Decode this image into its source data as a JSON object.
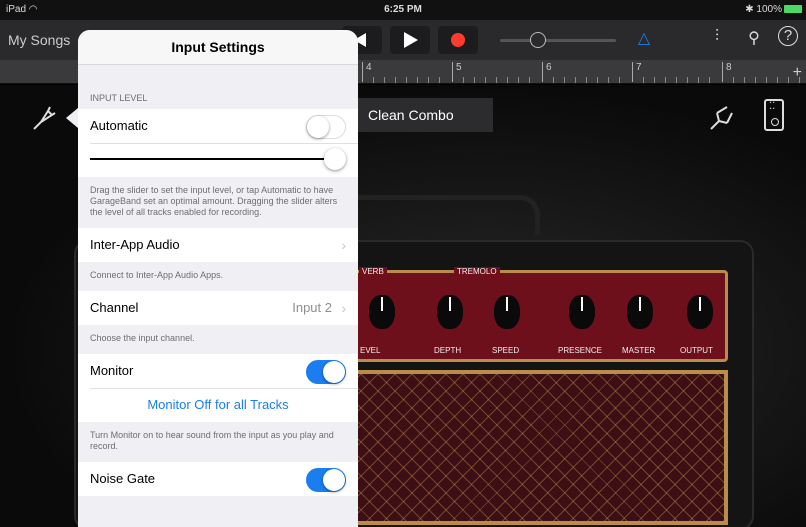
{
  "status": {
    "device": "iPad",
    "wifi": "wifi-icon",
    "time": "6:25 PM",
    "bluetooth": "bluetooth-icon",
    "battery": "100%"
  },
  "toolbar": {
    "songs_label": "My Songs"
  },
  "ruler": {
    "bars": [
      "4",
      "5",
      "6",
      "7",
      "8"
    ]
  },
  "track": {
    "preset_name": "Clean Combo"
  },
  "amp": {
    "top_labels": [
      "VERB",
      "TREMOLO"
    ],
    "bottom_labels": [
      "EVEL",
      "DEPTH",
      "SPEED",
      "PRESENCE",
      "MASTER",
      "OUTPUT"
    ]
  },
  "popover": {
    "title": "Input Settings",
    "input_level": {
      "header": "INPUT LEVEL",
      "automatic_label": "Automatic",
      "automatic_on": false,
      "level": 1.0,
      "footer": "Drag the slider to set the input level, or tap Automatic to have GarageBand set an optimal amount. Dragging the slider alters the level of all tracks enabled for recording."
    },
    "inter_app": {
      "label": "Inter-App Audio",
      "footer": "Connect to Inter-App Audio Apps."
    },
    "channel": {
      "label": "Channel",
      "value": "Input 2",
      "footer": "Choose the input channel."
    },
    "monitor": {
      "label": "Monitor",
      "on": true,
      "off_all_label": "Monitor Off for all Tracks",
      "footer": "Turn Monitor on to hear sound from the input as you play and record."
    },
    "noise_gate": {
      "label": "Noise Gate",
      "on": true
    }
  },
  "colors": {
    "accent": "#1a7ef0",
    "record": "#ff3b30",
    "amp_panel": "#6e0f1c",
    "amp_trim": "#b88d4a"
  }
}
